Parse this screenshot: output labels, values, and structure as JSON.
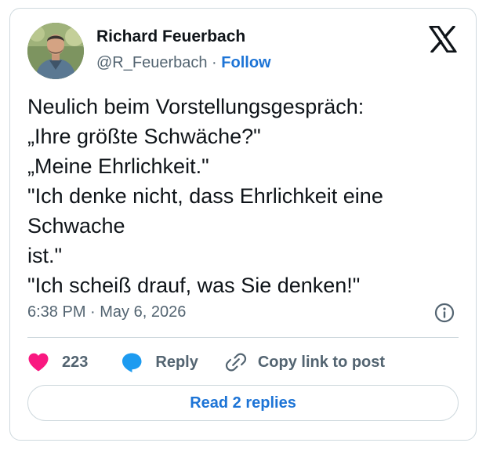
{
  "author": {
    "name": "Richard Feuerbach",
    "handle": "@R_Feuerbach",
    "separator": "·",
    "follow_label": "Follow"
  },
  "logo": {
    "icon": "x-logo-icon"
  },
  "tweet": {
    "lines": [
      "Neulich beim Vorstellungsgespräch:",
      "„Ihre größte Schwäche?\"",
      "„Meine Ehrlichkeit.\"",
      "\"Ich denke nicht, dass Ehrlichkeit eine",
      "Schwache",
      "ist.\"",
      "\"Ich scheiß drauf, was Sie denken!\""
    ],
    "timestamp": "6:38 PM · May 6, 2026"
  },
  "actions": {
    "like_count": "223",
    "reply_label": "Reply",
    "copy_link_label": "Copy link to post"
  },
  "read_replies_label": "Read 2 replies",
  "colors": {
    "accent_blue": "#1d74d6",
    "heart": "#f91880",
    "reply_bubble": "#1d9bf0",
    "text": "#0f1419",
    "secondary_text": "#536471",
    "border": "#cfd9de"
  }
}
